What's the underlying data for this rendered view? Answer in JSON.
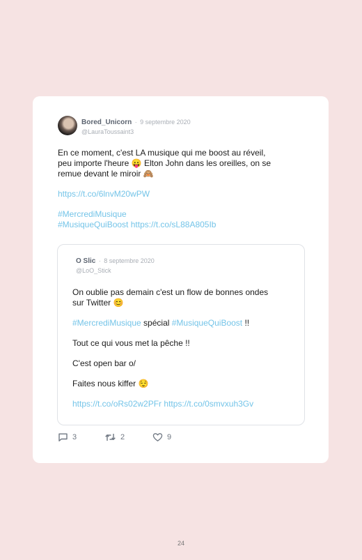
{
  "tweet": {
    "author": {
      "name": "Bored_Unicorn",
      "handle": "@LauraToussaint3"
    },
    "date": "9 septembre 2020",
    "text_line_1": "En ce moment, c'est LA musique qui me boost au réveil,",
    "text_line_2": "peu importe l'heure 😛 Elton John dans les oreilles, on se",
    "text_line_3": "remue devant le miroir 🙈",
    "link_1": "https://t.co/6lnvM20wPW",
    "hashtag_1": "#MercrediMusique",
    "hashtag_2": "#MusiqueQuiBoost",
    "link_2": "https://t.co/sL88A805Ib",
    "stats": {
      "replies": "3",
      "retweets": "2",
      "likes": "9"
    }
  },
  "quoted_tweet": {
    "author": {
      "name": "O Slic",
      "handle": "@LoO_Stick"
    },
    "date": "8 septembre 2020",
    "line_1": "On oublie pas demain c'est un flow de bonnes ondes",
    "line_2": "sur Twitter 😊",
    "hashtag_1": "#MercrediMusique",
    "text_special": " spécial ",
    "hashtag_2": "#MusiqueQuiBoost",
    "text_excl": " !!",
    "line_4": "Tout ce qui vous met la pêche !!",
    "line_5": "C'est open bar o/",
    "line_6": "Faites nous kiffer 😌",
    "link_1": "https://t.co/oRs02w2PFr",
    "link_2": "https://t.co/0smvxuh3Gv"
  },
  "page_number": "24",
  "colors": {
    "background": "#f6e3e3",
    "card": "#ffffff",
    "link": "#74c4e8"
  },
  "icons": {
    "reply": "reply-icon",
    "retweet": "retweet-icon",
    "like": "heart-icon"
  }
}
